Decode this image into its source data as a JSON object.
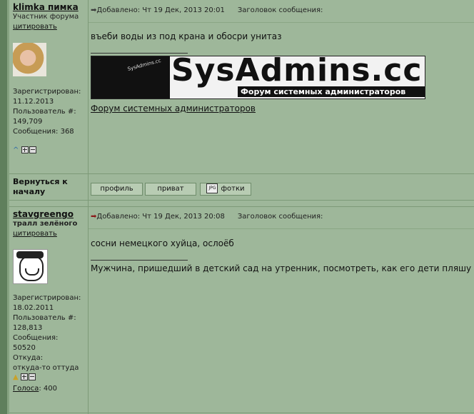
{
  "posts": [
    {
      "author": {
        "name": "klimka пимка",
        "rank": "Участник форума",
        "cite": "цитировать",
        "registered_label": "Зарегистрирован:",
        "registered": "11.12.2013",
        "user_no_label": "Пользователь #:",
        "user_no": "149,709",
        "messages_label": "Сообщения:",
        "messages": "368"
      },
      "meta": {
        "posted": "Добавлено: Чт 19 Дек, 2013 20:01",
        "subject": "Заголовок сообщения:"
      },
      "body": "въеби воды из под крана и обосри унитаз",
      "signature": {
        "banner_title": "SysAdmins.cc",
        "banner_subtitle": "Форум системных администраторов",
        "banner_mini": "SysAdmins.cc",
        "link": "Форум системных администраторов"
      }
    },
    {
      "author": {
        "name": "stavgreengo",
        "rank": "тралл зелёного",
        "cite": "цитировать",
        "registered_label": "Зарегистрирован:",
        "registered": "18.02.2011",
        "user_no_label": "Пользователь #:",
        "user_no": "128,813",
        "messages_label": "Сообщения:",
        "messages": "50520",
        "from_label": "Откуда:",
        "from": "откуда-то оттуда",
        "votes_label": "Голоса",
        "votes": ": 400"
      },
      "meta": {
        "posted": "Добавлено: Чт 19 Дек, 2013 20:08",
        "subject": "Заголовок сообщения:"
      },
      "body": "сосни немецкого хуйца, ослоёб",
      "signature": {
        "text": "Мужчина, пришедший в детский сад на утренник, посмотреть, как его дети пляшу"
      }
    }
  ],
  "footer": {
    "back_to_top": "Вернуться к началу",
    "buttons": {
      "profile": "профиль",
      "private": "приват",
      "photos": "фотки",
      "photos_icon_text": "JPG"
    }
  },
  "icons": {
    "post_arrow": "arrow-right-icon",
    "toggle": "plus-minus-icon"
  }
}
